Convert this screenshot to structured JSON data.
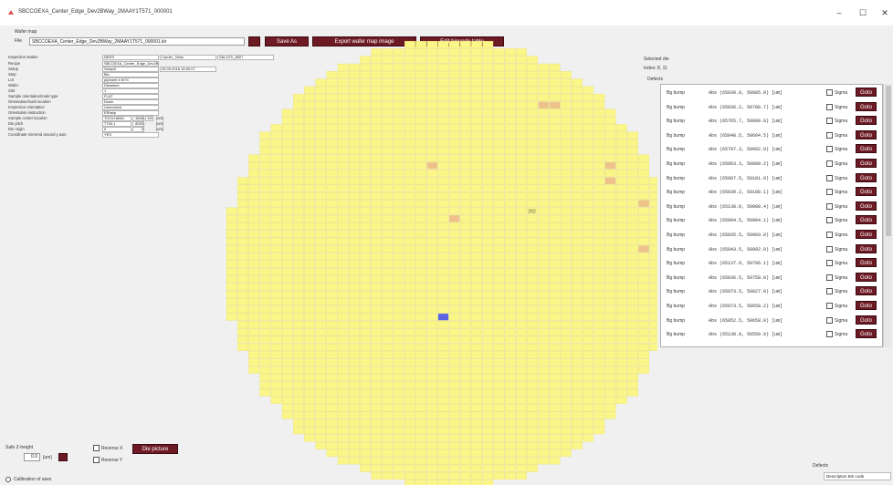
{
  "window": {
    "title": "SBCCOEXA_Center_Edge_Dev2BWay_2MAAY1T571_000001",
    "minimize": "–",
    "maximize": "☐",
    "close": "✕"
  },
  "wafer_map_label": "Wafer map",
  "file": {
    "label": "File",
    "value": "SBCCOEXA_Center_Edge_Dev2BWay_2MAAY1T571_000001.klr"
  },
  "buttons": {
    "save_as": "Save As",
    "export_image": "Export wafer map image",
    "edit_bincode": "Edit bincode table",
    "die_picture": "Die picture"
  },
  "info": {
    "header": [
      "Inspection station",
      "NERS",
      "Carrier_Telan",
      "SALOTh_8007"
    ],
    "rows": [
      {
        "label": "Recipe",
        "value": "SBCOEXA_Center_Edge_Dev2BWay"
      },
      {
        "label": "Setup",
        "value": "Setup8",
        "extra": "05.09.2016 18:00:07"
      },
      {
        "label": "Step",
        "value": "Bin"
      },
      {
        "label": "Lot",
        "value": "pipepert e fe74"
      },
      {
        "label": "Wafer",
        "value": "Dieselect"
      },
      {
        "label": "Slot",
        "value": "1"
      },
      {
        "label": "Sample orientation/mark type",
        "value": "FLAT"
      },
      {
        "label": "Orientation/mark location",
        "value": "Down"
      },
      {
        "label": "Inspection orientation",
        "value": "Unevolved"
      },
      {
        "label": "Orientation instruction",
        "value": "ERhelp"
      },
      {
        "label": "Sample center location",
        "value": "TOOLHAND",
        "v2": "4848",
        "v3": "100",
        "unit": "[um]"
      },
      {
        "label": "Die pitch",
        "value": "7726.1",
        "v2": "8093",
        "unit": "[um]"
      },
      {
        "label": "Die origin",
        "value": "0",
        "v2": "0",
        "unit": "[um]"
      },
      {
        "label": "Coordinate mirrored around y axis",
        "value": "YES"
      }
    ]
  },
  "selected_die": {
    "label": "Selected die",
    "index": "Index: 8, 11"
  },
  "defects_label": "Defects",
  "defects": [
    {
      "name": "Bg bump",
      "coord": "Abs (65030.0, 50905.0) [um]",
      "sigma": "Sigma",
      "goto": "Goto"
    },
    {
      "name": "Bg bump",
      "coord": "Abs (65036.2, 50700.7) [um]",
      "sigma": "Sigma",
      "goto": "Goto"
    },
    {
      "name": "Bg bump",
      "coord": "Abs (65765.7, 50600.0) [um]",
      "sigma": "Sigma",
      "goto": "Goto"
    },
    {
      "name": "Bg bump",
      "coord": "Abs (65048.5, 50604.5) [um]",
      "sigma": "Sigma",
      "goto": "Goto"
    },
    {
      "name": "Bg bump",
      "coord": "Abs (65797.3, 50002.0) [um]",
      "sigma": "Sigma",
      "goto": "Goto"
    },
    {
      "name": "Bg bump",
      "coord": "Abs (65063.3, 50089.2) [um]",
      "sigma": "Sigma",
      "goto": "Goto"
    },
    {
      "name": "Bg bump",
      "coord": "Abs (65007.5, 50181.0) [um]",
      "sigma": "Sigma",
      "goto": "Goto"
    },
    {
      "name": "Bg bump",
      "coord": "Abs (65030.2, 50180.1) [um]",
      "sigma": "Sigma",
      "goto": "Goto"
    },
    {
      "name": "Bg bump",
      "coord": "Abs (65138.0, 50008.4) [um]",
      "sigma": "Sigma",
      "goto": "Goto"
    },
    {
      "name": "Bg bump",
      "coord": "Abs (65004.5, 50904.1) [um]",
      "sigma": "Sigma",
      "goto": "Goto"
    },
    {
      "name": "Bg bump",
      "coord": "Abs (65035.5, 50903.0) [um]",
      "sigma": "Sigma",
      "goto": "Goto"
    },
    {
      "name": "Bg bump",
      "coord": "Abs (65043.5, 50902.0) [um]",
      "sigma": "Sigma",
      "goto": "Goto"
    },
    {
      "name": "Bg bump",
      "coord": "Abs (65137.9, 50796.1) [um]",
      "sigma": "Sigma",
      "goto": "Goto"
    },
    {
      "name": "Bg bump",
      "coord": "Abs (65036.5, 50758.0) [um]",
      "sigma": "Sigma",
      "goto": "Goto"
    },
    {
      "name": "Bg bump",
      "coord": "Abs (65073.5, 50827.0) [um]",
      "sigma": "Sigma",
      "goto": "Goto"
    },
    {
      "name": "Bg bump",
      "coord": "Abs (65073.5, 50658.2) [um]",
      "sigma": "Sigma",
      "goto": "Goto"
    },
    {
      "name": "Bg bump",
      "coord": "Abs (65052.5, 50658.0) [um]",
      "sigma": "Sigma",
      "goto": "Goto"
    },
    {
      "name": "Bg bump",
      "coord": "Abs (65138.0, 50550.9) [um]",
      "sigma": "Sigma",
      "goto": "Goto"
    }
  ],
  "die_label": "292",
  "safe_z": {
    "label": "Safe Z-height",
    "value": "0.0",
    "unit": "[um]"
  },
  "reverse_x": "Reverse X",
  "reverse_y": "Reverse Y",
  "calibration": "Calibration of axes",
  "defects_mini": {
    "label": "Defects",
    "header": "Description   Bin code"
  },
  "colors": {
    "die_fill": "#fbf688",
    "die_stroke": "#e9e174",
    "die_defect": "#eec28a",
    "die_selected": "#5b64e0",
    "button_dark": "#6d1a25"
  }
}
